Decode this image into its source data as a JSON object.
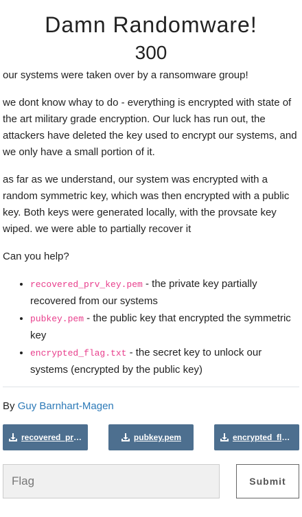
{
  "challenge": {
    "title": "Damn Randomware!",
    "points": "300"
  },
  "description": {
    "p1": "our systems were taken over by a ransomware group!",
    "p2": "we dont know whay to do - everything is encrypted with state of the art military grade encryption. Our luck has run out, the attackers have deleted the key used to encrypt our systems, and we only have a small portion of it.",
    "p3": "as far as we understand, our system was encrypted with a random symmetric key, which was then encrypted with a public key. Both keys were generated locally, with the provsate key wiped. we were able to partially recover it",
    "p4": "Can you help?",
    "items": [
      {
        "code": "recovered_prv_key.pem",
        "text": " - the private key partially recovered from our systems"
      },
      {
        "code": "pubkey.pem",
        "text": " - the public key that encrypted the symmetric key"
      },
      {
        "code": "encrypted_flag.txt",
        "text": " - the secret key to unlock our systems (encrypted by the public key)"
      }
    ]
  },
  "author": {
    "prefix": "By ",
    "name": "Guy Barnhart-Magen"
  },
  "files": [
    {
      "label": "recovered_prv_key.pem",
      "icon": "download-icon"
    },
    {
      "label": "pubkey.pem",
      "icon": "download-icon"
    },
    {
      "label": "encrypted_flag.txt",
      "icon": "download-icon"
    }
  ],
  "form": {
    "flag_placeholder": "Flag",
    "submit_label": "Submit"
  },
  "colors": {
    "file_button": "#4d6f8f",
    "code": "#e83e8c",
    "link": "#2d7ab8"
  }
}
